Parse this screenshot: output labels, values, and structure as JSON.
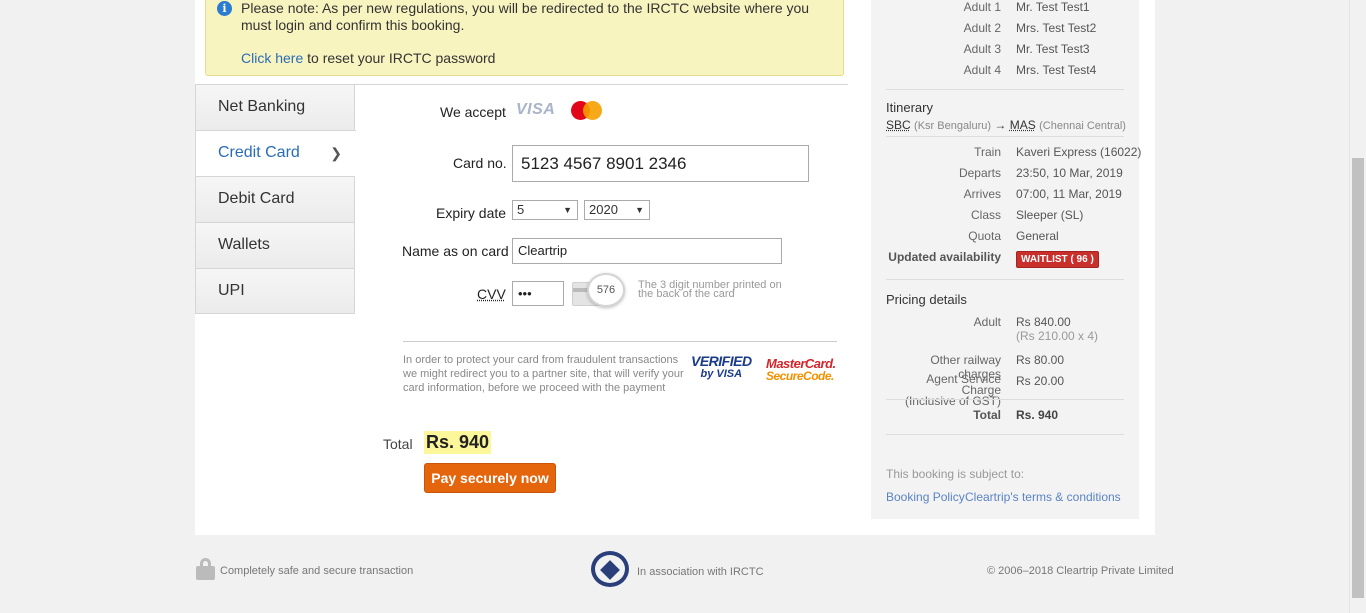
{
  "notice": {
    "message": "Please note: As per new regulations, you will be redirected to the IRCTC website where you must login and confirm this booking.",
    "reset_link": "Click here",
    "reset_suffix": " to reset your IRCTC password"
  },
  "tabs": [
    {
      "label": "Net Banking"
    },
    {
      "label": "Credit Card",
      "active": true
    },
    {
      "label": "Debit Card"
    },
    {
      "label": "Wallets"
    },
    {
      "label": "UPI"
    }
  ],
  "form": {
    "we_accept": "We accept",
    "visa_logo_text": "VISA",
    "card_no_label": "Card no.",
    "card_no_value": "5123 4567 8901 2346",
    "expiry_label": "Expiry date",
    "expiry_month": "5",
    "expiry_year": "2020",
    "name_label": "Name as on card",
    "name_value": "Cleartrip",
    "cvv_label": "CVV",
    "cvv_value": "•••",
    "cvv_sample": "576",
    "cvv_hint": "The 3 digit number printed on the back of the card",
    "protect_text": "In order to protect your card from fraudulent transactions we might redirect you to a partner site, that will verify your card information, before we proceed with the payment",
    "vbv_line1": "VERIFIED",
    "vbv_line2": "by VISA",
    "mcsc_line1": "MasterCard.",
    "mcsc_line2": "SecureCode."
  },
  "total": {
    "label": "Total",
    "value": "Rs. 940"
  },
  "pay_button": "Pay securely now",
  "summary": {
    "travellers": [
      {
        "key": "Adult 1",
        "value": "Mr. Test Test1"
      },
      {
        "key": "Adult 2",
        "value": "Mrs. Test Test2"
      },
      {
        "key": "Adult 3",
        "value": "Mr. Test Test3"
      },
      {
        "key": "Adult 4",
        "value": "Mrs. Test Test4"
      }
    ],
    "itinerary_title": "Itinerary",
    "from_code": "SBC",
    "from_name": "(Ksr Bengaluru)",
    "arrow": "→",
    "to_code": "MAS",
    "to_name": "(Chennai Central)",
    "details": [
      {
        "key": "Train",
        "value": "Kaveri Express (16022)"
      },
      {
        "key": "Departs",
        "value": "23:50, 10 Mar, 2019"
      },
      {
        "key": "Arrives",
        "value": "07:00, 11 Mar, 2019"
      },
      {
        "key": "Class",
        "value": "Sleeper (SL)"
      },
      {
        "key": "Quota",
        "value": "General"
      }
    ],
    "availability_label": "Updated availability",
    "availability_value": "WAITLIST ( 96 )",
    "pricing_title": "Pricing details",
    "adult_label": "Adult",
    "adult_value": "Rs 840.00",
    "adult_sub": "(Rs 210.00 x 4)",
    "other_label": "Other railway charges",
    "other_value": "Rs 80.00",
    "agent_label1": "Agent Service Charge",
    "agent_label2": "(Inclusive of GST)",
    "agent_value": "Rs 20.00",
    "total_label": "Total",
    "total_value": "Rs. 940",
    "subject_text": "This booking is subject to:",
    "policy_link": "Booking Policy",
    "terms_link": "Cleartrip's terms & conditions"
  },
  "footer": {
    "secure_text": "Completely safe and secure transaction",
    "association_text": "In association with IRCTC",
    "copyright": "© 2006–2018 Cleartrip Private Limited"
  },
  "colors": {
    "accent_link": "#2a6bb5",
    "pay_button": "#e5650d",
    "waitlist_badge": "#c9302c",
    "notice_bg": "#f8f4c0"
  }
}
